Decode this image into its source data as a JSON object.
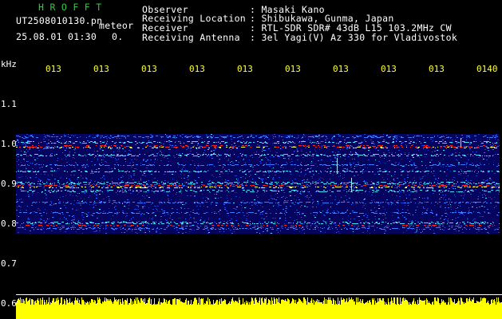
{
  "header": {
    "program": "H R O F F T",
    "filename": "UT2508010130.pn",
    "tag": "meteor",
    "datetime": "25.08.01 01:30",
    "marker": "0.",
    "observer_label": "Observer",
    "observer_value": ": Masaki Kano",
    "location_label": "Receiving Location",
    "location_value": ": Shibukawa, Gunma, Japan",
    "receiver_label": "Receiver",
    "receiver_value": ": RTL-SDR SDR# 43dB L15 103.2MHz CW",
    "antenna_label": "Receiving Antenna",
    "antenna_value": ": 3el Yagi(V) Az 330 for Vladivostok"
  },
  "axis": {
    "unit": "kHz",
    "yticks": [
      "1.1",
      "1.0",
      "0.9",
      "0.8",
      "0.7",
      "0.6"
    ],
    "time_labels": [
      "013",
      "013",
      "013",
      "013",
      "013",
      "013",
      "013",
      "013",
      "013",
      "0140"
    ]
  },
  "colors": {
    "background": "#000000",
    "waterfall_base": "#050560",
    "signal_red": "#ff2020",
    "signal_cyan": "#44ddff",
    "noise_yellow": "#ffff00"
  }
}
